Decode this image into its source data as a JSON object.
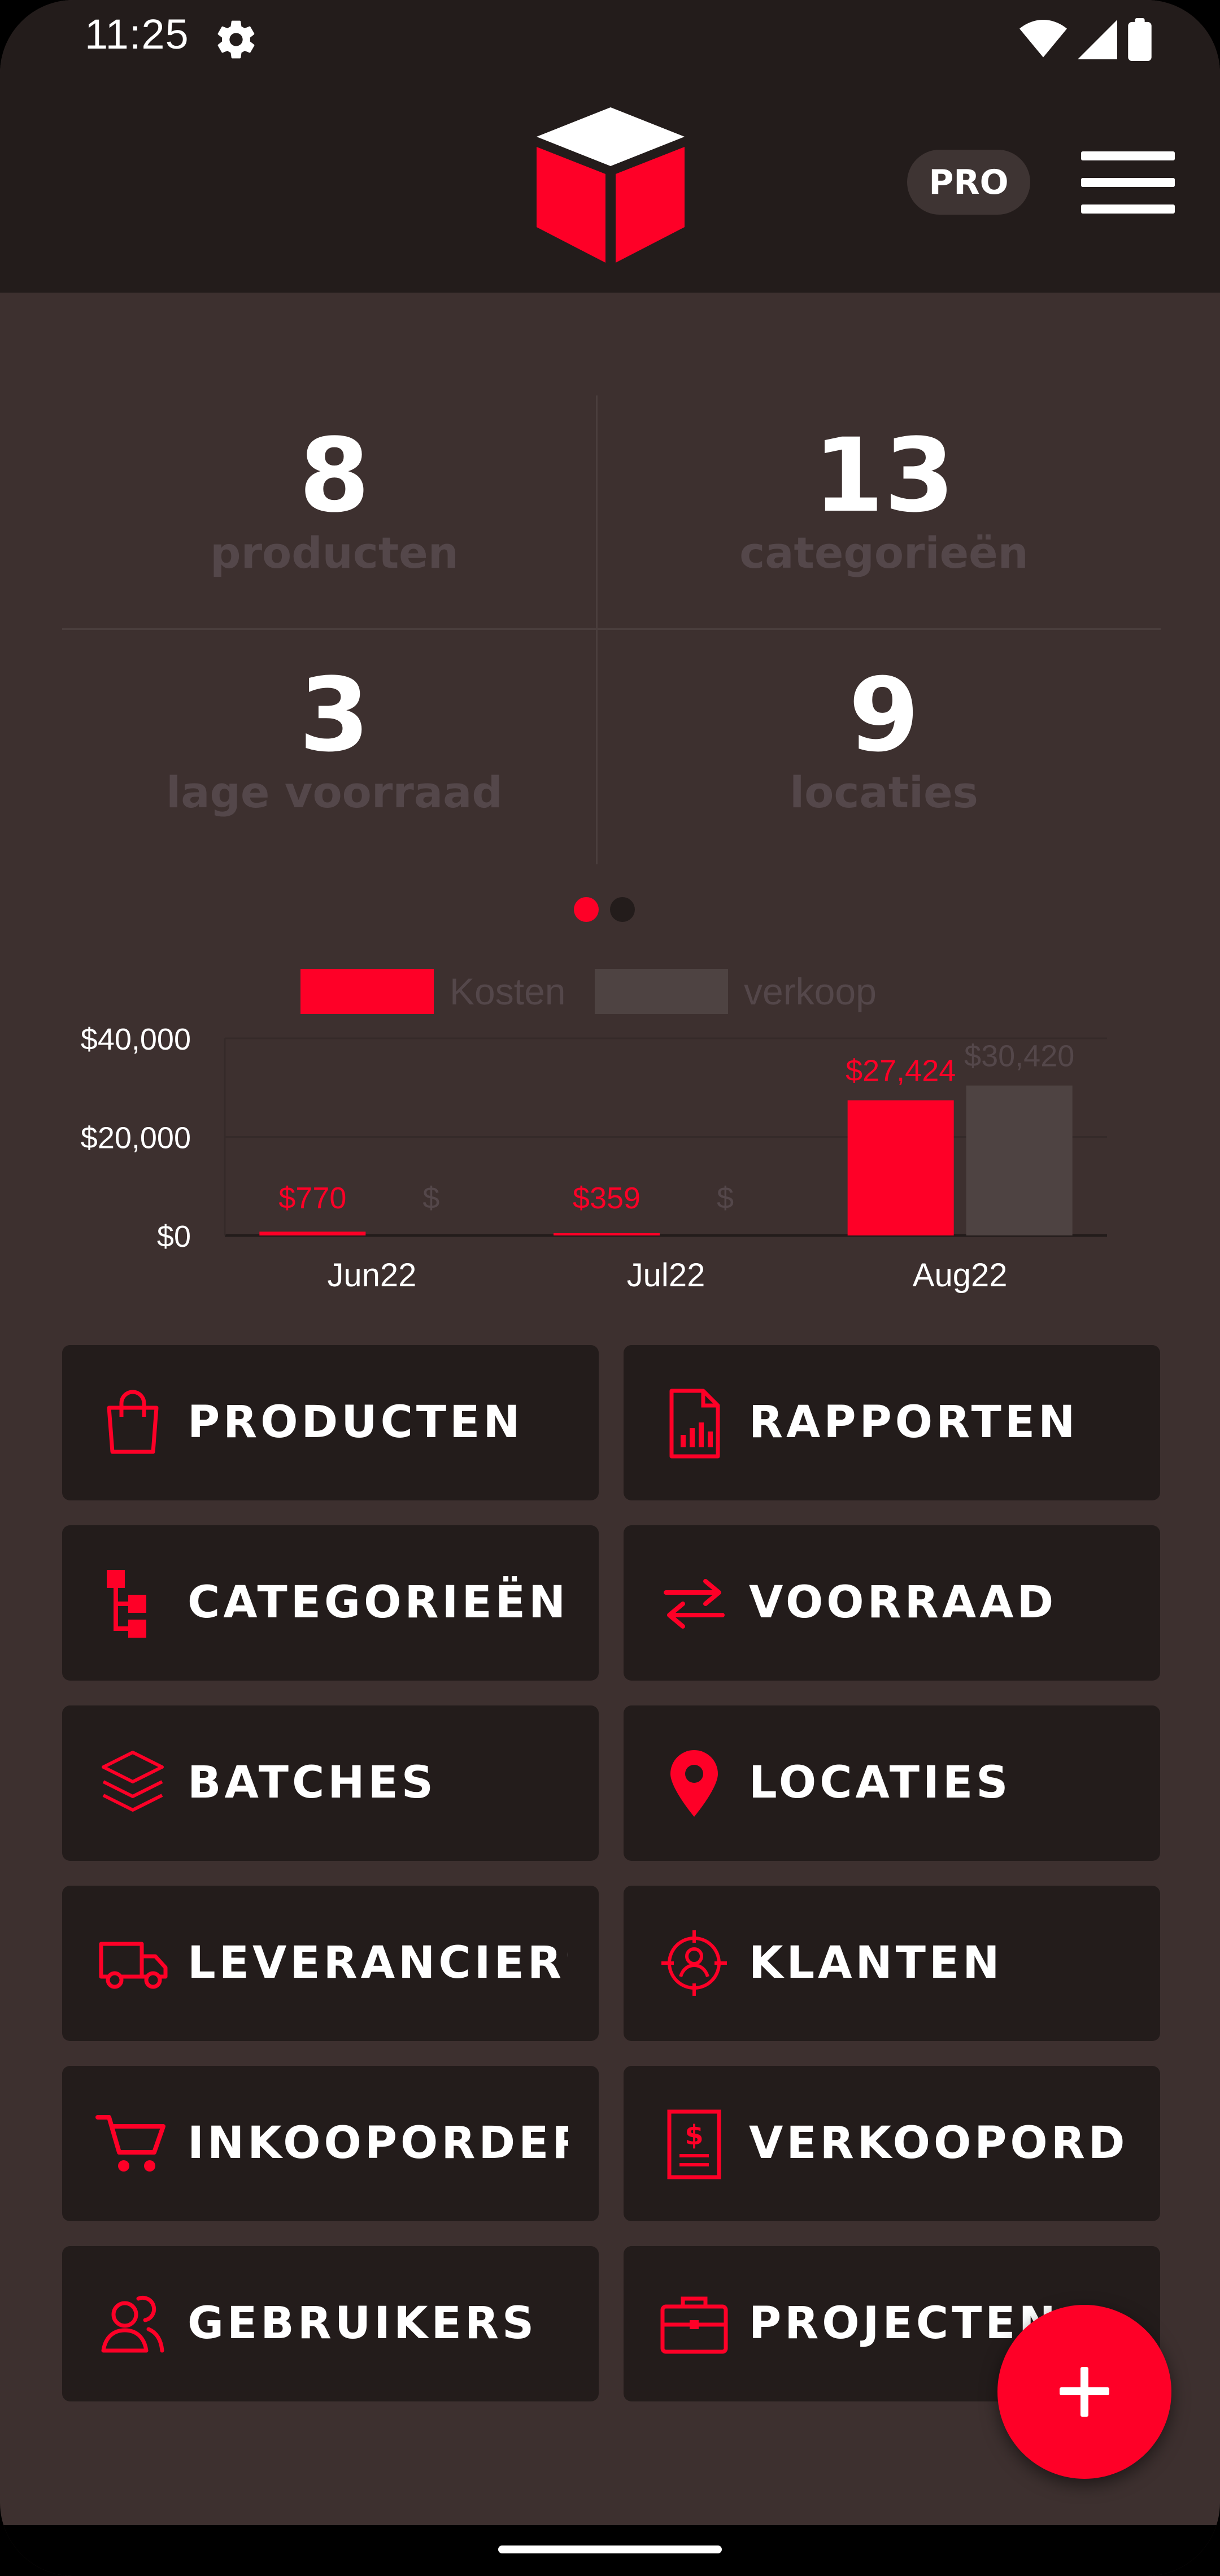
{
  "status_bar": {
    "time": "11:25"
  },
  "app_bar": {
    "pro_label": "PRO"
  },
  "stats": [
    {
      "value": "8",
      "label": "producten"
    },
    {
      "value": "13",
      "label": "categorieën"
    },
    {
      "value": "3",
      "label": "lage voorraad"
    },
    {
      "value": "9",
      "label": "locaties"
    }
  ],
  "pager": {
    "pages": 2,
    "active": 0
  },
  "chart_data": {
    "type": "bar",
    "categories": [
      "Jun22",
      "Jul22",
      "Aug22"
    ],
    "series": [
      {
        "name": "Kosten",
        "values": [
          770,
          359,
          27424
        ],
        "labels": [
          "$770",
          "$359",
          "$27,424"
        ],
        "color": "#fe0027"
      },
      {
        "name": "verkoop",
        "values": [
          0,
          0,
          30420
        ],
        "labels": [
          "$",
          "$",
          "$30,420"
        ],
        "color": "#4e4342"
      }
    ],
    "y_ticks": [
      "$40,000",
      "$20,000",
      "$0"
    ],
    "y_tick_values": [
      40000,
      20000,
      0
    ],
    "ylim": [
      0,
      40000
    ],
    "legend_position": "top-center",
    "grid": true
  },
  "menu_buttons": [
    {
      "label": "PRODUCTEN",
      "icon": "shopping-bag-icon"
    },
    {
      "label": "RAPPORTEN",
      "icon": "report-document-icon"
    },
    {
      "label": "CATEGORIEËN",
      "icon": "hierarchy-icon"
    },
    {
      "label": "VOORRAAD",
      "icon": "transfer-arrows-icon"
    },
    {
      "label": "BATCHES",
      "icon": "layers-icon"
    },
    {
      "label": "LOCATIES",
      "icon": "location-pin-icon"
    },
    {
      "label": "LEVERANCIERS",
      "icon": "truck-icon"
    },
    {
      "label": "KLANTEN",
      "icon": "customer-target-icon"
    },
    {
      "label": "INKOOPORDERS",
      "icon": "shopping-cart-icon"
    },
    {
      "label": "VERKOOPORDERS",
      "icon": "invoice-dollar-icon"
    },
    {
      "label": "GEBRUIKERS",
      "icon": "users-icon"
    },
    {
      "label": "PROJECTEN",
      "icon": "briefcase-icon"
    }
  ],
  "fab": {
    "icon": "plus-icon"
  },
  "colors": {
    "accent": "#fe0027",
    "background": "#3d302f",
    "surface": "#231c1b",
    "muted_text": "#54474a",
    "verkoop_bar": "#4e4342"
  }
}
